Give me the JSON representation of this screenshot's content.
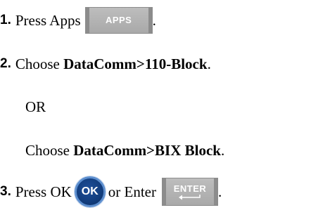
{
  "steps": [
    {
      "number": "1.",
      "text": "Press Apps",
      "key_label": "APPS",
      "trailing": "."
    },
    {
      "number": "2.",
      "prefix": "Choose ",
      "bold": "DataComm>110-Block",
      "trailing": "."
    },
    {
      "or_label": "OR"
    },
    {
      "prefix": "Choose ",
      "bold": "DataComm>BIX Block",
      "trailing": "."
    },
    {
      "number": "3.",
      "text": "Press OK",
      "ok_label": "OK",
      "middle": "or Enter",
      "key_label": "ENTER",
      "trailing": "."
    }
  ],
  "colors": {
    "key_face": "#a9a9a9",
    "ok_fill": "#123d7d",
    "ok_ring": "#5d8fcf"
  },
  "icons": {
    "apps_key": "apps-key-icon",
    "ok_button": "ok-button-icon",
    "enter_key": "enter-key-icon",
    "enter_arrow": "return-arrow-icon"
  }
}
